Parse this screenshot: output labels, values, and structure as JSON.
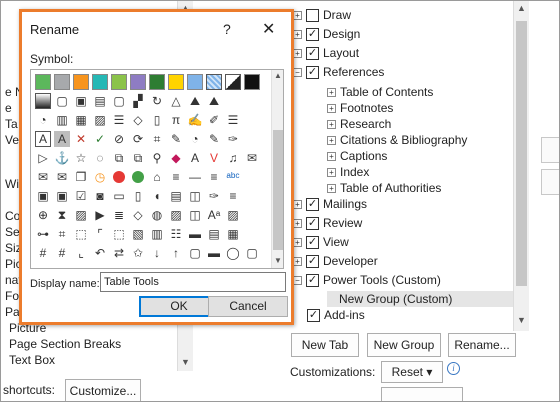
{
  "dialog": {
    "title": "Rename",
    "help": "?",
    "close": "✕",
    "symbol_label": "Symbol:",
    "display_name_label": "Display name:",
    "display_name_value": "Table Tools",
    "ok_label": "OK",
    "cancel_label": "Cancel",
    "border_color": "#ec7c2c"
  },
  "symbols": [
    [
      "green-square",
      "gray-square",
      "orange-square",
      "teal-square",
      "olive-square",
      "purple-square",
      "dark-green-square",
      "yellow-square",
      "blue-square",
      "blue-hatched-square",
      "half-dark-square",
      "black-square",
      "",
      "",
      ""
    ],
    [
      "gradient-square",
      "border-box",
      "shadow-box",
      "gray-box",
      "white-box",
      "checker-icon",
      "circle-arrow-icon",
      "triangle-icon",
      "mountain-icon",
      "mountain-picture-icon",
      "",
      "",
      "",
      "",
      ""
    ],
    [
      "pie-chart-icon",
      "bar-chart-icon",
      "table-icon",
      "image-icon",
      "stack-icon",
      "shape-icon",
      "page-icon",
      "pi-icon",
      "signature-icon",
      "paint-icon",
      "list-icon",
      "",
      "",
      "",
      ""
    ],
    [
      "text-a-icon",
      "text-a-shaded-icon",
      "red-x-icon",
      "green-check-icon",
      "no-icon",
      "cycle-icon",
      "tag-icon",
      "comment-icon",
      "bubble-icon",
      "pen-icon",
      "brush-icon",
      "",
      "",
      "",
      ""
    ],
    [
      "play-icon",
      "anchor-icon",
      "star-icon",
      "dashed-circle-icon",
      "copy-icon",
      "copy2-icon",
      "link-icon",
      "red-eraser-icon",
      "color-a-icon",
      "v-icon",
      "bell-icon",
      "envelope-icon",
      "",
      "",
      ""
    ],
    [
      "mail-icon",
      "mail-open-icon",
      "pages-icon",
      "clock-icon",
      "red-circle-icon",
      "green-circle-icon",
      "home-icon",
      "lines-icon",
      "dash-icon",
      "bars-icon",
      "abc-icon",
      "",
      "",
      "",
      ""
    ],
    [
      "cube-icon",
      "cube-plus-icon",
      "check-squares-icon",
      "camera-icon",
      "bookmark-icon",
      "doc-icon",
      "mouse-icon",
      "chart-icon",
      "layers-icon",
      "brush2-icon",
      "lines2-icon",
      "",
      "",
      "",
      ""
    ],
    [
      "zoom-icon",
      "hourglass-icon",
      "picture-icon",
      "video-icon",
      "lines3-icon",
      "diamond-icon",
      "palette-icon",
      "picture2-icon",
      "stacked-icon",
      "a-a-icon",
      "image2-icon",
      "",
      "",
      "",
      ""
    ],
    [
      "align-icon",
      "brackets-icon",
      "frame-icon",
      "crop-icon",
      "dashed-box-icon",
      "blocks-icon",
      "table-fill-icon",
      "lines4-icon",
      "ruler-icon",
      "table2-icon",
      "grid-icon",
      "",
      "",
      "",
      ""
    ],
    [
      "hashtag-icon",
      "hashtag2-icon",
      "crop2-icon",
      "undo-icon",
      "share-icon",
      "star2-icon",
      "down-icon",
      "up-icon",
      "box-icon",
      "colors-icon",
      "bubble2-icon",
      "box2-icon",
      "",
      "",
      ""
    ]
  ],
  "left_panel": {
    "items": [
      "e N",
      "e",
      "Ta",
      "Ve",
      "Wi",
      "Col",
      "Set",
      "Size",
      "Pic",
      "nat",
      "Fo",
      "Pa",
      "Picture",
      "Page  Section Breaks",
      "Text Box"
    ],
    "shortcuts_label": "shortcuts:",
    "customize_label": "Customize..."
  },
  "tree": [
    {
      "label": "Draw",
      "level": 0,
      "expander": "⊞",
      "checked": false
    },
    {
      "label": "Design",
      "level": 0,
      "expander": "⊞",
      "checked": true
    },
    {
      "label": "Layout",
      "level": 0,
      "expander": "⊞",
      "checked": true
    },
    {
      "label": "References",
      "level": 0,
      "expander": "⊟",
      "checked": true
    },
    {
      "label": "Table of Contents",
      "level": 1,
      "expander": "⊞"
    },
    {
      "label": "Footnotes",
      "level": 1,
      "expander": "⊞"
    },
    {
      "label": "Research",
      "level": 1,
      "expander": "⊞"
    },
    {
      "label": "Citations & Bibliography",
      "level": 1,
      "expander": "⊞"
    },
    {
      "label": "Captions",
      "level": 1,
      "expander": "⊞"
    },
    {
      "label": "Index",
      "level": 1,
      "expander": "⊞"
    },
    {
      "label": "Table of Authorities",
      "level": 1,
      "expander": "⊞"
    },
    {
      "label": "Mailings",
      "level": 0,
      "expander": "⊞",
      "checked": true
    },
    {
      "label": "Review",
      "level": 0,
      "expander": "⊞",
      "checked": true
    },
    {
      "label": "View",
      "level": 0,
      "expander": "⊞",
      "checked": true
    },
    {
      "label": "Developer",
      "level": 0,
      "expander": "⊞",
      "checked": true
    },
    {
      "label": "Power Tools (Custom)",
      "level": 0,
      "expander": "⊟",
      "checked": true
    },
    {
      "label": "New Group (Custom)",
      "level": 1,
      "expander": "",
      "selected": true
    },
    {
      "label": "Add-ins",
      "level": 0,
      "expander": "",
      "checked": true
    }
  ],
  "bottom": {
    "new_tab": "New Tab",
    "new_group": "New Group",
    "rename": "Rename...",
    "customizations_label": "Customizations:",
    "reset_label": "Reset ▾",
    "info": "i"
  },
  "colors": {
    "accent": "#0078d7",
    "dialog_border": "#ec7c2c",
    "selected_row": "#e5e5e5"
  }
}
